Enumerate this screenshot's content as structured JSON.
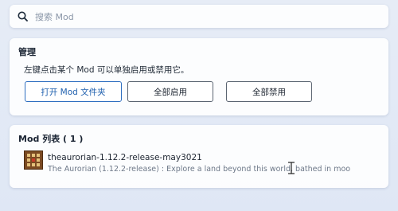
{
  "search": {
    "placeholder": "搜索 Mod",
    "icon": "search-icon"
  },
  "manage": {
    "title": "管理",
    "description": "左键点击某个 Mod 可以单独启用或禁用它。",
    "buttons": {
      "open_folder": "打开 Mod 文件夹",
      "enable_all": "全部启用",
      "disable_all": "全部禁用"
    }
  },
  "mod_list": {
    "title": "Mod 列表 ( 1 )",
    "items": [
      {
        "name": "theaurorian-1.12.2-release-may3021",
        "description": "The Aurorian (1.12.2-release) : Explore a land beyond this world, bathed in moo",
        "icon": "crafting-block-icon"
      }
    ]
  },
  "colors": {
    "accent": "#2f6fc0",
    "background": "#e2e9f5",
    "card": "#ffffff"
  }
}
